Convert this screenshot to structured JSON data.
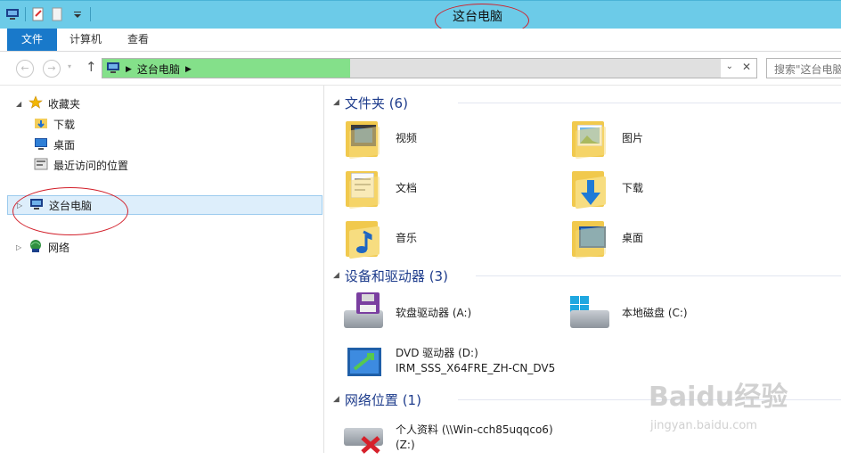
{
  "window": {
    "title": "这台电脑"
  },
  "ribbon": {
    "tabs": [
      {
        "label": "文件"
      },
      {
        "label": "计算机"
      },
      {
        "label": "查看"
      }
    ]
  },
  "address": {
    "crumb": "这台电脑",
    "progress_fraction": 0.4,
    "search_placeholder": "搜索\"这台电脑\""
  },
  "navpane": {
    "items": [
      {
        "label": "收藏夹",
        "icon": "star-icon"
      },
      {
        "label": "下载",
        "icon": "download-folder-icon"
      },
      {
        "label": "桌面",
        "icon": "desktop-icon"
      },
      {
        "label": "最近访问的位置",
        "icon": "recent-places-icon"
      },
      {
        "label": "这台电脑",
        "icon": "computer-icon"
      },
      {
        "label": "网络",
        "icon": "network-icon"
      }
    ]
  },
  "groups": {
    "folders": {
      "label": "文件夹 (6)"
    },
    "devices": {
      "label": "设备和驱动器 (3)"
    },
    "network": {
      "label": "网络位置 (1)"
    }
  },
  "folders": [
    {
      "label": "视频",
      "icon": "videos-folder-icon"
    },
    {
      "label": "图片",
      "icon": "pictures-folder-icon"
    },
    {
      "label": "文档",
      "icon": "documents-folder-icon"
    },
    {
      "label": "下载",
      "icon": "downloads-folder-icon"
    },
    {
      "label": "音乐",
      "icon": "music-folder-icon"
    },
    {
      "label": "桌面",
      "icon": "desktop-folder-icon"
    }
  ],
  "devices": [
    {
      "label": "软盘驱动器 (A:)",
      "icon": "floppy-drive-icon"
    },
    {
      "label": "本地磁盘 (C:)",
      "icon": "local-disk-icon"
    },
    {
      "label": "DVD 驱动器 (D:)",
      "sub": "IRM_SSS_X64FRE_ZH-CN_DV5",
      "icon": "dvd-drive-icon"
    }
  ],
  "network_locations": [
    {
      "label": "个人资料 (\\\\Win-cch85uqqco6)",
      "sub": "(Z:)",
      "icon": "disconnected-network-drive-icon"
    }
  ],
  "watermark": {
    "brand": "Baidu经验",
    "url": "jingyan.baidu.com"
  },
  "colors": {
    "titlebar": "#6ccbe8",
    "file_tab": "#1979ca",
    "group_heading": "#1e3c8c",
    "annotation": "#d21f2a"
  }
}
